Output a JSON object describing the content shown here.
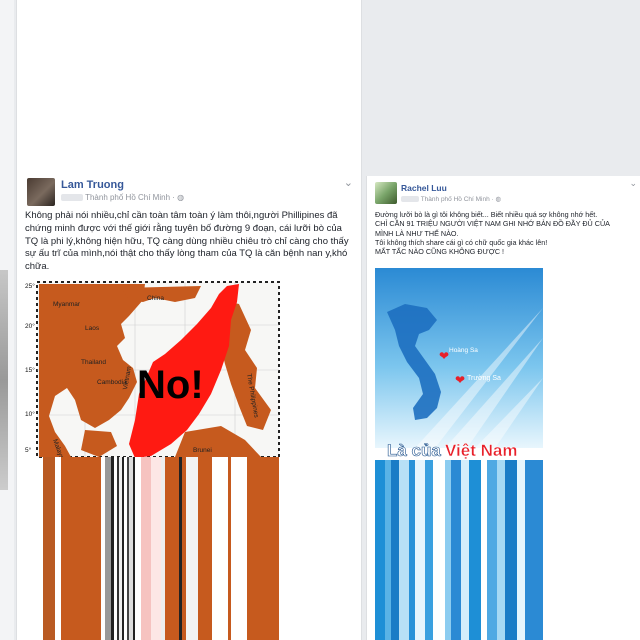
{
  "posts": [
    {
      "author": "Lam Truong",
      "location": "Thành phố Hồ Chí Minh",
      "text": "Không phải nói nhiều,chỉ cần toàn tâm toàn ý làm thôi,người Phillipines đã chứng minh được với thế giới rằng tuyên bố đường 9 đoạn, cái lưỡi bò của TQ là phi lý,không hiện hữu, TQ càng dùng nhiều chiêu trò chỉ càng cho thấy sự ấu trĩ của mình,nói thật cho thấy lòng tham của TQ là căn bệnh nan y,khó chữa.",
      "image": {
        "stamp": "No!",
        "labels": [
          "Myanmar",
          "China",
          "Laos",
          "Thailand",
          "Cambodia",
          "Vietnam",
          "Malaysia",
          "Brunei",
          "The Philippines"
        ],
        "lat_ticks": [
          "25°",
          "20°",
          "15°",
          "10°",
          "5°"
        ]
      }
    },
    {
      "author": "Rachel Luu",
      "location": "Thành phố Hồ Chí Minh",
      "lines": [
        "Đường lưỡi bò là gì tôi không biết... Biết nhiều quá sợ không nhớ hết.",
        "CHỈ CẦN 91 TRIỆU NGƯỜI VIỆT NAM GHI NHỚ BẢN ĐỒ ĐẦY ĐỦ CỦA MÌNH LÀ NHƯ THẾ NÀO.",
        "Tôi không thích share cái gì có chữ quốc gia khác lên!",
        "MẤT TẤC NÀO CŨNG KHÔNG ĐƯỢC !"
      ],
      "image": {
        "label_hoang_sa": "Hoàng Sa",
        "label_truong_sa": "Trường Sa",
        "banner_prefix": "Là của",
        "banner_highlight": "Việt Nam"
      }
    }
  ],
  "colors": {
    "link": "#365899",
    "map_land": "#c65a1e",
    "claim_red": "#ff1a12",
    "sea_blue": "#1e8fd6"
  }
}
